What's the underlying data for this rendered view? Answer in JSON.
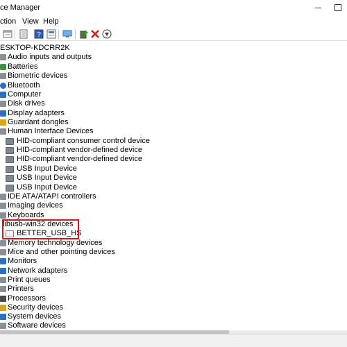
{
  "window": {
    "title": "ce Manager"
  },
  "menu": {
    "items": [
      "ction",
      "View",
      "Help"
    ]
  },
  "toolbar": {
    "icons": [
      "show-hidden-icon",
      "properties-icon",
      "help-icon",
      "scan-hardware-icon",
      "monitor-icon",
      "update-driver-icon",
      "uninstall-icon",
      "disable-device-icon"
    ]
  },
  "tree": {
    "root": "ESKTOP-KDCRR2K",
    "categories": [
      "Audio inputs and outputs",
      "Batteries",
      "Biometric devices",
      "Bluetooth",
      "Computer",
      "Disk drives",
      "Display adapters",
      "Guardant dongles",
      "Human Interface Devices",
      "IDE ATA/ATAPI controllers",
      "Imaging devices",
      "Keyboards",
      "libusb-win32 devices",
      "Memory technology devices",
      "Mice and other pointing devices",
      "Monitors",
      "Network adapters",
      "Print queues",
      "Printers",
      "Processors",
      "Security devices",
      "System devices",
      "Software devices"
    ],
    "hid_children": [
      "HID-compliant consumer control device",
      "HID-compliant vendor-defined device",
      "HID-compliant vendor-defined device",
      "USB Input Device",
      "USB Input Device",
      "USB Input Device"
    ],
    "libusb_children": [
      "BETTER_USB_HS"
    ]
  },
  "colors": {
    "highlight_border": "#d11a1a"
  }
}
